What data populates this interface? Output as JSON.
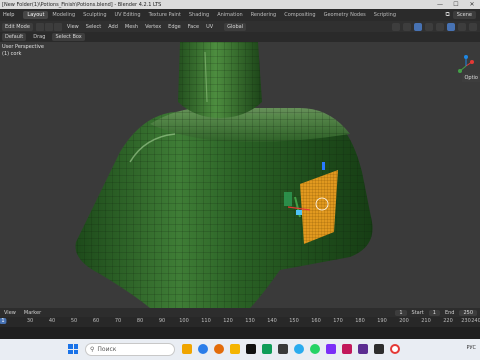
{
  "window": {
    "title": "[New Folder(1)\\Potions_Finish\\Potions.blend] - Blender 4.2.1 LTS",
    "controls": [
      "—",
      "☐",
      "✕"
    ]
  },
  "menu": {
    "left": [
      "Help"
    ],
    "workspaces": [
      "Layout",
      "Modeling",
      "Sculpting",
      "UV Editing",
      "Texture Paint",
      "Shading",
      "Animation",
      "Rendering",
      "Compositing",
      "Geometry Nodes",
      "Scripting"
    ],
    "active_workspace": "Layout",
    "scene_label": "Scene"
  },
  "header": {
    "mode": "Edit Mode",
    "menus": [
      "View",
      "Select",
      "Add",
      "Mesh",
      "Vertex",
      "Edge",
      "Face",
      "UV"
    ],
    "transform_orientation": "Global"
  },
  "toolbar": {
    "pivot": "Default",
    "drag_label": "Drag",
    "select_mode": "Select Box"
  },
  "viewport": {
    "perspective_label": "User Perspective",
    "object_label": "(1) cork",
    "options_label": "Optio"
  },
  "timeline": {
    "menus": [
      "View",
      "Marker"
    ],
    "current_frame": "1",
    "start_label": "Start",
    "start_value": "1",
    "end_label": "End",
    "end_value": "250",
    "ruler_ticks": [
      "30",
      "40",
      "50",
      "60",
      "70",
      "80",
      "90",
      "100",
      "110",
      "120",
      "130",
      "140",
      "150",
      "160",
      "170",
      "180",
      "190",
      "200",
      "210",
      "220",
      "230",
      "240"
    ],
    "ruler_left_marker": "1"
  },
  "taskbar": {
    "search_placeholder": "Поиск",
    "tray_text": "РУС"
  },
  "colors": {
    "accent": "#4772b3",
    "bottle_green": "#2f6b2a",
    "uv_face": "#f2a020"
  }
}
